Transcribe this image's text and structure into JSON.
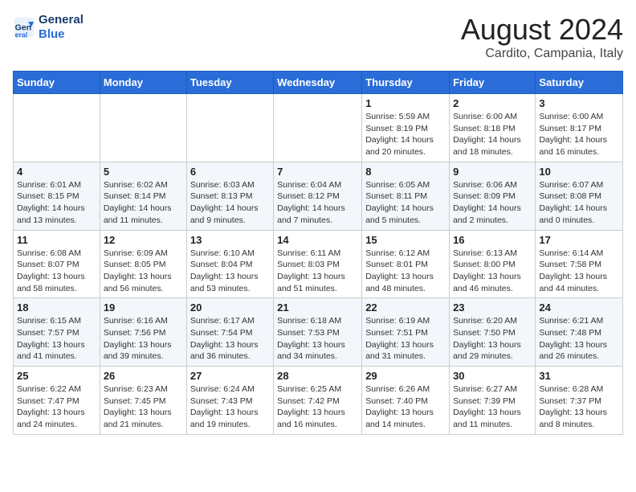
{
  "header": {
    "logo_line1": "General",
    "logo_line2": "Blue",
    "title": "August 2024",
    "subtitle": "Cardito, Campania, Italy"
  },
  "days_of_week": [
    "Sunday",
    "Monday",
    "Tuesday",
    "Wednesday",
    "Thursday",
    "Friday",
    "Saturday"
  ],
  "weeks": [
    [
      {
        "day": "",
        "info": ""
      },
      {
        "day": "",
        "info": ""
      },
      {
        "day": "",
        "info": ""
      },
      {
        "day": "",
        "info": ""
      },
      {
        "day": "1",
        "info": "Sunrise: 5:59 AM\nSunset: 8:19 PM\nDaylight: 14 hours and 20 minutes."
      },
      {
        "day": "2",
        "info": "Sunrise: 6:00 AM\nSunset: 8:18 PM\nDaylight: 14 hours and 18 minutes."
      },
      {
        "day": "3",
        "info": "Sunrise: 6:00 AM\nSunset: 8:17 PM\nDaylight: 14 hours and 16 minutes."
      }
    ],
    [
      {
        "day": "4",
        "info": "Sunrise: 6:01 AM\nSunset: 8:15 PM\nDaylight: 14 hours and 13 minutes."
      },
      {
        "day": "5",
        "info": "Sunrise: 6:02 AM\nSunset: 8:14 PM\nDaylight: 14 hours and 11 minutes."
      },
      {
        "day": "6",
        "info": "Sunrise: 6:03 AM\nSunset: 8:13 PM\nDaylight: 14 hours and 9 minutes."
      },
      {
        "day": "7",
        "info": "Sunrise: 6:04 AM\nSunset: 8:12 PM\nDaylight: 14 hours and 7 minutes."
      },
      {
        "day": "8",
        "info": "Sunrise: 6:05 AM\nSunset: 8:11 PM\nDaylight: 14 hours and 5 minutes."
      },
      {
        "day": "9",
        "info": "Sunrise: 6:06 AM\nSunset: 8:09 PM\nDaylight: 14 hours and 2 minutes."
      },
      {
        "day": "10",
        "info": "Sunrise: 6:07 AM\nSunset: 8:08 PM\nDaylight: 14 hours and 0 minutes."
      }
    ],
    [
      {
        "day": "11",
        "info": "Sunrise: 6:08 AM\nSunset: 8:07 PM\nDaylight: 13 hours and 58 minutes."
      },
      {
        "day": "12",
        "info": "Sunrise: 6:09 AM\nSunset: 8:05 PM\nDaylight: 13 hours and 56 minutes."
      },
      {
        "day": "13",
        "info": "Sunrise: 6:10 AM\nSunset: 8:04 PM\nDaylight: 13 hours and 53 minutes."
      },
      {
        "day": "14",
        "info": "Sunrise: 6:11 AM\nSunset: 8:03 PM\nDaylight: 13 hours and 51 minutes."
      },
      {
        "day": "15",
        "info": "Sunrise: 6:12 AM\nSunset: 8:01 PM\nDaylight: 13 hours and 48 minutes."
      },
      {
        "day": "16",
        "info": "Sunrise: 6:13 AM\nSunset: 8:00 PM\nDaylight: 13 hours and 46 minutes."
      },
      {
        "day": "17",
        "info": "Sunrise: 6:14 AM\nSunset: 7:58 PM\nDaylight: 13 hours and 44 minutes."
      }
    ],
    [
      {
        "day": "18",
        "info": "Sunrise: 6:15 AM\nSunset: 7:57 PM\nDaylight: 13 hours and 41 minutes."
      },
      {
        "day": "19",
        "info": "Sunrise: 6:16 AM\nSunset: 7:56 PM\nDaylight: 13 hours and 39 minutes."
      },
      {
        "day": "20",
        "info": "Sunrise: 6:17 AM\nSunset: 7:54 PM\nDaylight: 13 hours and 36 minutes."
      },
      {
        "day": "21",
        "info": "Sunrise: 6:18 AM\nSunset: 7:53 PM\nDaylight: 13 hours and 34 minutes."
      },
      {
        "day": "22",
        "info": "Sunrise: 6:19 AM\nSunset: 7:51 PM\nDaylight: 13 hours and 31 minutes."
      },
      {
        "day": "23",
        "info": "Sunrise: 6:20 AM\nSunset: 7:50 PM\nDaylight: 13 hours and 29 minutes."
      },
      {
        "day": "24",
        "info": "Sunrise: 6:21 AM\nSunset: 7:48 PM\nDaylight: 13 hours and 26 minutes."
      }
    ],
    [
      {
        "day": "25",
        "info": "Sunrise: 6:22 AM\nSunset: 7:47 PM\nDaylight: 13 hours and 24 minutes."
      },
      {
        "day": "26",
        "info": "Sunrise: 6:23 AM\nSunset: 7:45 PM\nDaylight: 13 hours and 21 minutes."
      },
      {
        "day": "27",
        "info": "Sunrise: 6:24 AM\nSunset: 7:43 PM\nDaylight: 13 hours and 19 minutes."
      },
      {
        "day": "28",
        "info": "Sunrise: 6:25 AM\nSunset: 7:42 PM\nDaylight: 13 hours and 16 minutes."
      },
      {
        "day": "29",
        "info": "Sunrise: 6:26 AM\nSunset: 7:40 PM\nDaylight: 13 hours and 14 minutes."
      },
      {
        "day": "30",
        "info": "Sunrise: 6:27 AM\nSunset: 7:39 PM\nDaylight: 13 hours and 11 minutes."
      },
      {
        "day": "31",
        "info": "Sunrise: 6:28 AM\nSunset: 7:37 PM\nDaylight: 13 hours and 8 minutes."
      }
    ]
  ]
}
